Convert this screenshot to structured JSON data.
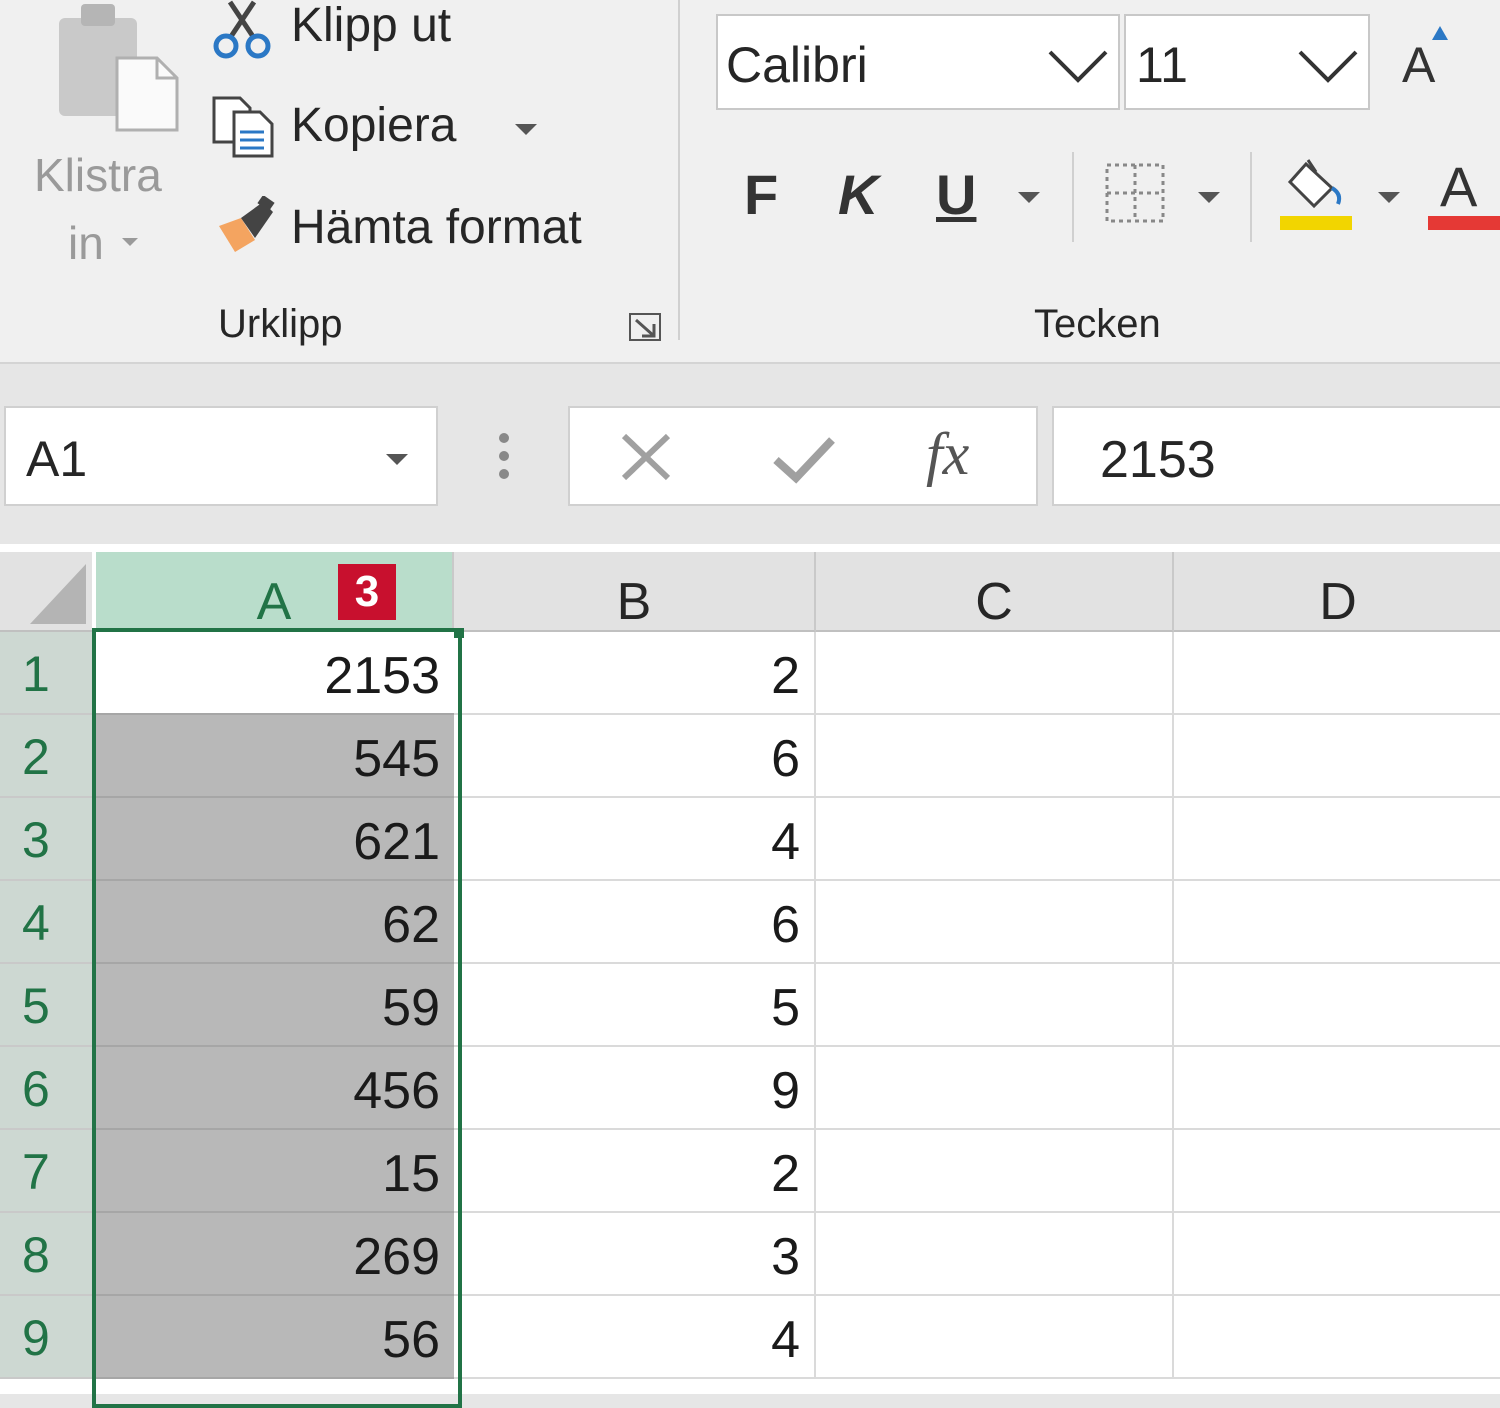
{
  "ribbon": {
    "clipboard": {
      "paste_label_line1": "Klistra",
      "paste_label_line2": "in",
      "cut_label": "Klipp ut",
      "copy_label": "Kopiera",
      "format_painter_label": "Hämta format",
      "group_label": "Urklipp"
    },
    "font": {
      "font_name": "Calibri",
      "font_size": "11",
      "grow_font_label": "A",
      "bold_label": "F",
      "italic_label": "K",
      "underline_label": "U",
      "font_color_label": "A",
      "group_label": "Tecken"
    },
    "colors": {
      "highlight": "#f2d500",
      "font_color": "#e53935",
      "excel_green": "#217346",
      "badge": "#c8102e"
    }
  },
  "formula_bar": {
    "name_box": "A1",
    "formula_value": "2153",
    "fx_label": "fx"
  },
  "sheet": {
    "columns": [
      "A",
      "B",
      "C",
      "D"
    ],
    "badge_number": "3",
    "rows": [
      {
        "row": "1",
        "A": "2153",
        "B": "2"
      },
      {
        "row": "2",
        "A": "545",
        "B": "6"
      },
      {
        "row": "3",
        "A": "621",
        "B": "4"
      },
      {
        "row": "4",
        "A": "62",
        "B": "6"
      },
      {
        "row": "5",
        "A": "59",
        "B": "5"
      },
      {
        "row": "6",
        "A": "456",
        "B": "9"
      },
      {
        "row": "7",
        "A": "15",
        "B": "2"
      },
      {
        "row": "8",
        "A": "269",
        "B": "3"
      },
      {
        "row": "9",
        "A": "56",
        "B": "4"
      }
    ]
  }
}
